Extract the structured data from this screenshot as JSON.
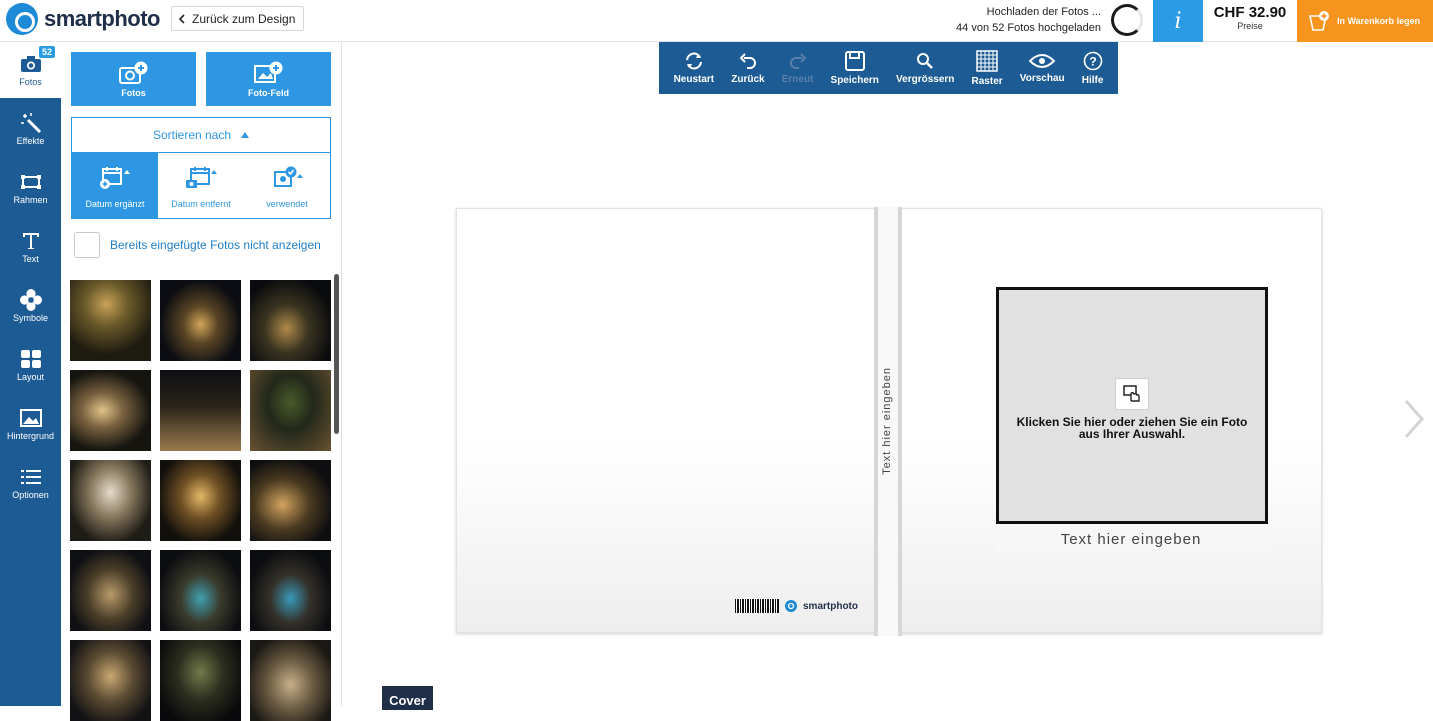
{
  "brand": {
    "name": "smartphoto"
  },
  "header": {
    "back_label": "Zurück zum Design",
    "upload_title": "Hochladen der Fotos ...",
    "upload_progress": "44 von 52 Fotos hochgeladen",
    "price": "CHF 32.90",
    "price_label": "Preise",
    "cart_label": "In Warenkorb legen",
    "info_label": "i"
  },
  "sidebar": {
    "photo_count": "52",
    "items": [
      {
        "label": "Fotos",
        "icon": "camera-icon"
      },
      {
        "label": "Effekte",
        "icon": "magic-wand-icon"
      },
      {
        "label": "Rahmen",
        "icon": "frame-icon"
      },
      {
        "label": "Text",
        "icon": "text-icon"
      },
      {
        "label": "Symbole",
        "icon": "flower-icon"
      },
      {
        "label": "Layout",
        "icon": "layout-icon"
      },
      {
        "label": "Hintergrund",
        "icon": "image-icon"
      },
      {
        "label": "Optionen",
        "icon": "list-icon"
      }
    ]
  },
  "panel": {
    "add_photos_label": "Fotos",
    "add_field_label": "Foto-Feld",
    "sort_label": "Sortieren nach",
    "sort_options": [
      "Datum ergänzt",
      "Datum entfernt",
      "verwendet"
    ],
    "hide_used_label": "Bereits eingefügte Fotos nicht anzeigen"
  },
  "toolbar": {
    "items": [
      {
        "label": "Neustart",
        "icon": "refresh-icon"
      },
      {
        "label": "Zurück",
        "icon": "undo-icon"
      },
      {
        "label": "Erneut",
        "icon": "redo-icon"
      },
      {
        "label": "Speichern",
        "icon": "save-icon"
      },
      {
        "label": "Vergrössern",
        "icon": "zoom-icon"
      },
      {
        "label": "Raster",
        "icon": "grid-icon"
      },
      {
        "label": "Vorschau",
        "icon": "eye-icon"
      },
      {
        "label": "Hilfe",
        "icon": "help-icon"
      }
    ]
  },
  "book": {
    "spine_text": "Text hier eingeben",
    "slot_text": "Klicken Sie hier oder ziehen Sie ein Foto aus Ihrer Auswahl.",
    "caption": "Text hier eingeben",
    "back_brand": "smartphoto"
  },
  "page_tab": "Cover",
  "colors": {
    "primary": "#1d5b95",
    "accent": "#2e97e3",
    "cart": "#f7941d"
  }
}
